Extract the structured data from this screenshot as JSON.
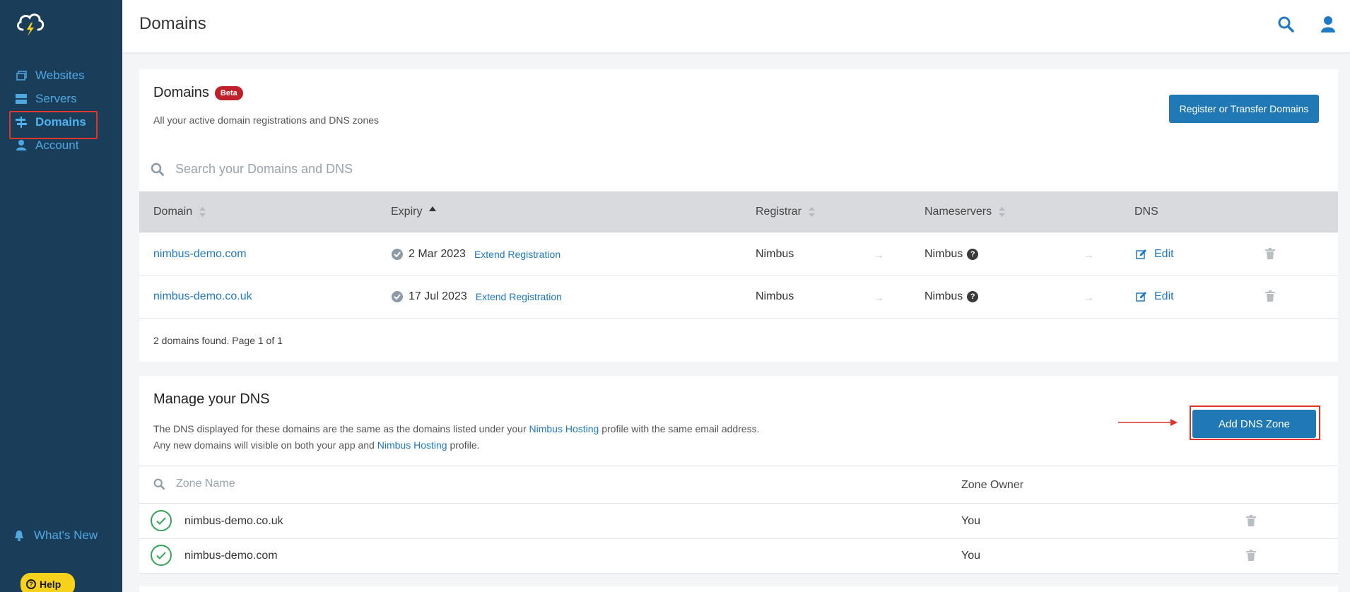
{
  "topbar": {
    "title": "Domains"
  },
  "sidebar": {
    "items": [
      {
        "label": "Websites",
        "icon": "websites-icon"
      },
      {
        "label": "Servers",
        "icon": "servers-icon"
      },
      {
        "label": "Domains",
        "icon": "domains-icon",
        "active": true
      },
      {
        "label": "Account",
        "icon": "account-icon"
      }
    ],
    "whats_new": "What's New",
    "help": "Help"
  },
  "domains_card": {
    "title": "Domains",
    "badge": "Beta",
    "subtitle": "All your active domain registrations and DNS zones",
    "register_button": "Register or Transfer Domains",
    "search_placeholder": "Search your Domains and DNS",
    "columns": [
      "Domain",
      "Expiry",
      "Registrar",
      "Nameservers",
      "DNS"
    ],
    "rows": [
      {
        "domain": "nimbus-demo.com",
        "expiry": "2 Mar 2023",
        "extend": "Extend Registration",
        "registrar": "Nimbus",
        "nameservers": "Nimbus",
        "dns": "Edit"
      },
      {
        "domain": "nimbus-demo.co.uk",
        "expiry": "17 Jul 2023",
        "extend": "Extend Registration",
        "registrar": "Nimbus",
        "nameservers": "Nimbus",
        "dns": "Edit"
      }
    ],
    "footer": "2 domains found. Page 1 of 1"
  },
  "dns_card": {
    "title": "Manage your DNS",
    "desc_line1_pre": "The DNS displayed for these domains are the same as the domains listed under your ",
    "desc_line1_link": "Nimbus Hosting",
    "desc_line1_post": " profile with the same email address.",
    "desc_line2_pre": "Any new domains will visible on both your app and ",
    "desc_line2_link": "Nimbus Hosting",
    "desc_line2_post": " profile.",
    "add_button": "Add DNS Zone",
    "zone_search_placeholder": "Zone Name",
    "zone_owner_header": "Zone Owner",
    "zones": [
      {
        "name": "nimbus-demo.co.uk",
        "owner": "You"
      },
      {
        "name": "nimbus-demo.com",
        "owner": "You"
      }
    ]
  },
  "colors": {
    "sidebar": "#1a3d5a",
    "primary": "#2079b4",
    "danger": "#c0202a",
    "success": "#33a356",
    "help": "#f6d21c"
  }
}
